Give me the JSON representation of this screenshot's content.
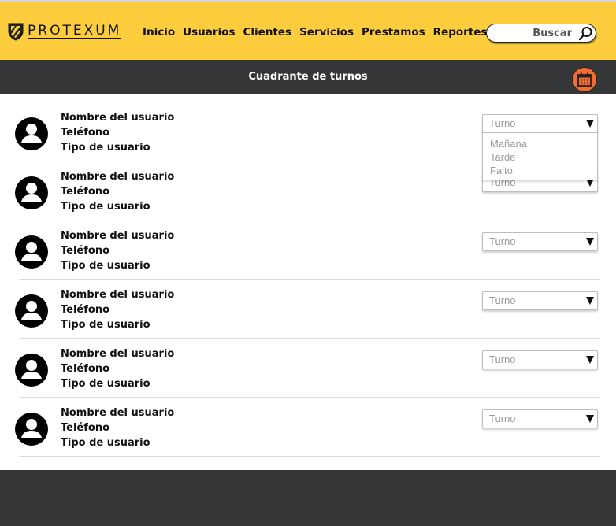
{
  "brand": {
    "name": "PROTEXUM"
  },
  "nav": [
    "Inicio",
    "Usuarios",
    "Clientes",
    "Servicios",
    "Prestamos",
    "Reportes"
  ],
  "search": {
    "placeholder": "Buscar"
  },
  "subheader": {
    "title": "Cuadrante de turnos"
  },
  "colors": {
    "topbar": "#fecd3d",
    "dark": "#353638",
    "accent": "#f06c34"
  },
  "users": [
    {
      "name": "Nombre del usuario",
      "phone": "Teléfono",
      "type": "Tipo de usuario",
      "shift": "Turno"
    },
    {
      "name": "Nombre del usuario",
      "phone": "Teléfono",
      "type": "Tipo de usuario",
      "shift": "Turno"
    },
    {
      "name": "Nombre del usuario",
      "phone": "Teléfono",
      "type": "Tipo de usuario",
      "shift": "Turno"
    },
    {
      "name": "Nombre del usuario",
      "phone": "Teléfono",
      "type": "Tipo de usuario",
      "shift": "Turno"
    },
    {
      "name": "Nombre del usuario",
      "phone": "Teléfono",
      "type": "Tipo de usuario",
      "shift": "Turno"
    },
    {
      "name": "Nombre del usuario",
      "phone": "Teléfono",
      "type": "Tipo de usuario",
      "shift": "Turno"
    }
  ],
  "shift_options": [
    "Mañana",
    "Tarde",
    "Falto"
  ]
}
